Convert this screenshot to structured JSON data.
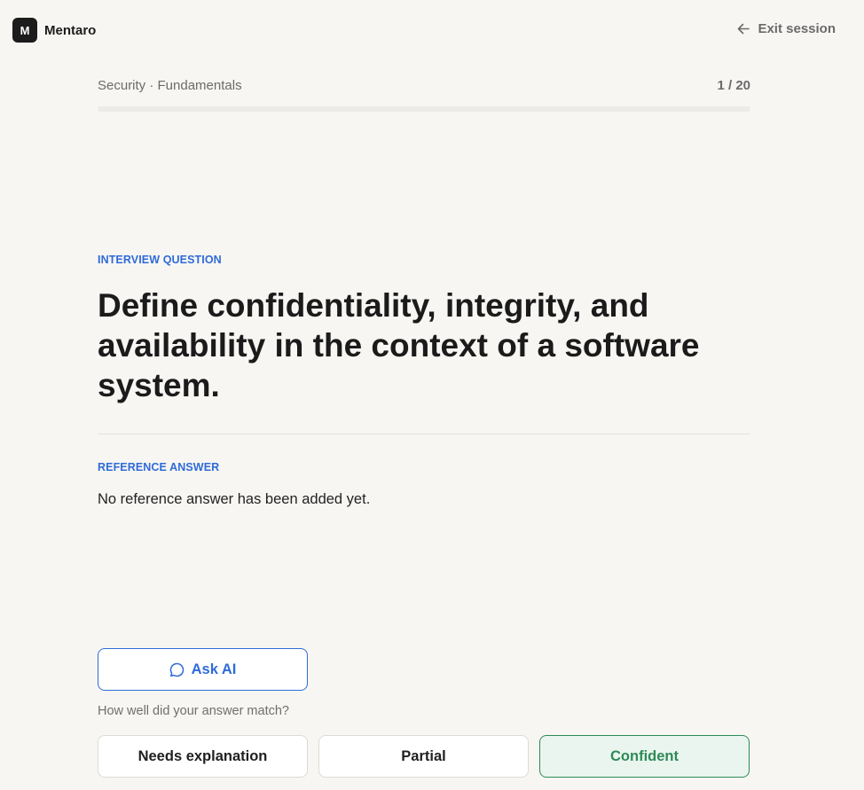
{
  "app": {
    "logo_letter": "M",
    "name": "Mentaro"
  },
  "header": {
    "exit_label": "Exit session",
    "exit_icon": "arrow-left-icon"
  },
  "progress": {
    "breadcrumb": "Security · Fundamentals",
    "counter": "1 / 20",
    "current": 1,
    "total": 20
  },
  "question": {
    "section_label": "INTERVIEW QUESTION",
    "text": "Define confidentiality, integrity, and availability in the context of a software system."
  },
  "reference": {
    "section_label": "REFERENCE ANSWER",
    "text": "No reference answer has been added yet."
  },
  "ask_ai": {
    "label": "Ask AI",
    "icon": "chat-bubble-icon"
  },
  "rating": {
    "prompt": "How well did your answer match?",
    "options": [
      {
        "label": "Needs explanation"
      },
      {
        "label": "Partial"
      },
      {
        "label": "Confident"
      }
    ]
  },
  "colors": {
    "accent_blue": "#2f6bd8",
    "confident_green": "#2e8a57",
    "confident_bg": "#eaf5ef",
    "background": "#f7f6f3"
  }
}
